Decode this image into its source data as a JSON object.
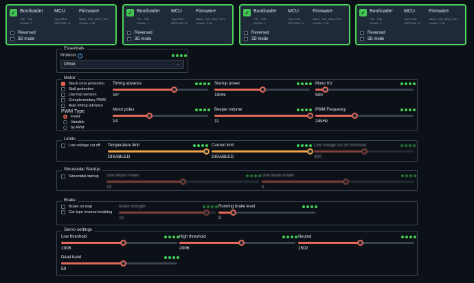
{
  "esc_cards": [
    {
      "bootloader": "Bootloader",
      "pin_label": "PIN",
      "pin_value": "PA2",
      "version_label": "Version",
      "version_value": "1",
      "mcu": "MCU",
      "mcu_type": "Type:F421",
      "mcu_eeprom": "EEPROM: v2",
      "firmware": "Firmware",
      "fw_name_label": "Name",
      "fw_name_value": "FAK_4IN1_F421",
      "fw_version_label": "Version",
      "fw_version_value": "2.18",
      "reversed": "Reversed",
      "mode3d": "3D mode"
    },
    {
      "bootloader": "Bootloader",
      "pin_label": "PIN",
      "pin_value": "PA2",
      "version_label": "Version",
      "version_value": "1",
      "mcu": "MCU",
      "mcu_type": "Type:F421",
      "mcu_eeprom": "EEPROM: v2",
      "firmware": "Firmware",
      "fw_name_label": "Name",
      "fw_name_value": "FAK_4IN1_F421",
      "fw_version_label": "Version",
      "fw_version_value": "2.18",
      "reversed": "Reversed",
      "mode3d": "3D mode"
    },
    {
      "bootloader": "Bootloader",
      "pin_label": "PIN",
      "pin_value": "PA2",
      "version_label": "Version",
      "version_value": "1",
      "mcu": "MCU",
      "mcu_type": "Type:F421",
      "mcu_eeprom": "EEPROM: v2",
      "firmware": "Firmware",
      "fw_name_label": "Name",
      "fw_name_value": "FAK_4IN1_F421",
      "fw_version_label": "Version",
      "fw_version_value": "2.18",
      "reversed": "Reversed",
      "mode3d": "3D mode"
    },
    {
      "bootloader": "Bootloader",
      "pin_label": "PIN",
      "pin_value": "PA2",
      "version_label": "Version",
      "version_value": "1",
      "mcu": "MCU",
      "mcu_type": "Type:F421",
      "mcu_eeprom": "EEPROM: v2",
      "firmware": "Firmware",
      "fw_name_label": "Name",
      "fw_name_value": "FAK_4IN1_F421",
      "fw_version_label": "Version",
      "fw_version_value": "2.18",
      "reversed": "Reversed",
      "mode3d": "3D mode"
    }
  ],
  "essentials": {
    "title": "Essentials",
    "protocol_label": "Protocol",
    "protocol_value": "DShot"
  },
  "motor": {
    "title": "Motor",
    "checkboxes": [
      "Stuck rotor protection",
      "Stall protection",
      "Use hall sensors",
      "Complementary PWM",
      "Auto timing advance"
    ],
    "pwm_type_label": "PWM Type",
    "pwm_options": [
      "Fixed",
      "Variable",
      "by RPM"
    ],
    "timing_label": "Timing advance",
    "timing_value": "15°",
    "timing_level": 0.64,
    "startup_label": "Startup power",
    "startup_value": "100%",
    "startup_level": 0.5,
    "kv_label": "Motor KV",
    "kv_value": "900",
    "kv_level": 0.1,
    "poles_label": "Motor poles",
    "poles_value": "14",
    "poles_level": 0.38,
    "beeper_label": "Beeper volume",
    "beeper_value": "11",
    "beeper_level": 1.0,
    "pwmfreq_label": "PWM Frequency",
    "pwmfreq_value": "24kHz",
    "pwmfreq_level": 0.4
  },
  "limits": {
    "title": "Limits",
    "lv_cutoff": "Low voltage cut off",
    "temp_label": "Temperature limit",
    "temp_value": "DISABLED",
    "temp_level": 1.0,
    "current_label": "Current limit",
    "current_value": "DISABLED",
    "current_level": 1.0,
    "lv_threshold_label": "Low voltage cut off threshold",
    "lv_threshold_value": "300",
    "lv_threshold_level": 0.5
  },
  "sinusoidal": {
    "title": "Sinusoidal Startup",
    "checkbox": "Sinusoidal startup",
    "sine_mode_label": "Sine Mode Power",
    "sine_mode_value": "15",
    "sine_mode_level": 0.5,
    "sine_mode2_label": "Sine Mode Power",
    "sine_mode2_value": "6",
    "sine_mode2_level": 0.55
  },
  "brake": {
    "title": "Brake",
    "brake_on_stop": "Brake on stop",
    "reverse_braking": "Car type reverse breaking",
    "strength_label": "Brake strength",
    "strength_value": "10",
    "strength_level": 0.9,
    "running_label": "Running brake level",
    "running_value": "2",
    "running_level": 0.15
  },
  "servo": {
    "title": "Servo settings",
    "low_label": "Low threshold",
    "low_value": "1006",
    "low_level": 0.53,
    "high_label": "High threshold",
    "high_value": "2006",
    "high_level": 0.53,
    "neutral_label": "Neutral",
    "neutral_value": "1502",
    "neutral_level": 0.53,
    "dead_label": "Dead band",
    "dead_value": "50",
    "dead_level": 0.53
  },
  "colors": {
    "accent": "#e0624f",
    "green": "#43c552",
    "bg": "#0c1118",
    "card": "#1f2a39"
  }
}
